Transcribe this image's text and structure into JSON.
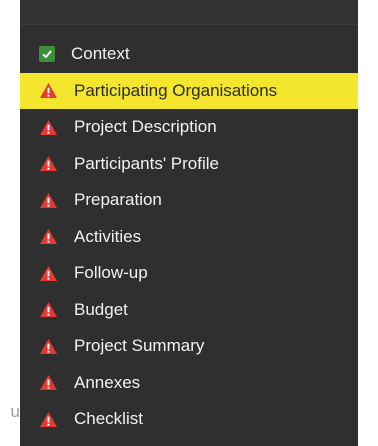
{
  "menu": {
    "items": [
      {
        "label": "Context",
        "status": "check-icon",
        "active": false
      },
      {
        "label": "Participating Organisations",
        "status": "warning-icon",
        "active": true
      },
      {
        "label": "Project Description",
        "status": "warning-icon",
        "active": false
      },
      {
        "label": "Participants' Profile",
        "status": "warning-icon",
        "active": false
      },
      {
        "label": "Preparation",
        "status": "warning-icon",
        "active": false
      },
      {
        "label": "Activities",
        "status": "warning-icon",
        "active": false
      },
      {
        "label": "Follow-up",
        "status": "warning-icon",
        "active": false
      },
      {
        "label": "Budget",
        "status": "warning-icon",
        "active": false
      },
      {
        "label": "Project Summary",
        "status": "warning-icon",
        "active": false
      },
      {
        "label": "Annexes",
        "status": "warning-icon",
        "active": false
      },
      {
        "label": "Checklist",
        "status": "warning-icon",
        "active": false
      }
    ]
  },
  "background_text": "u",
  "colors": {
    "panel_bg": "#2f2f2f",
    "active_bg": "#f3e62c",
    "warning": "#e53935",
    "check": "#3e8f3b"
  }
}
